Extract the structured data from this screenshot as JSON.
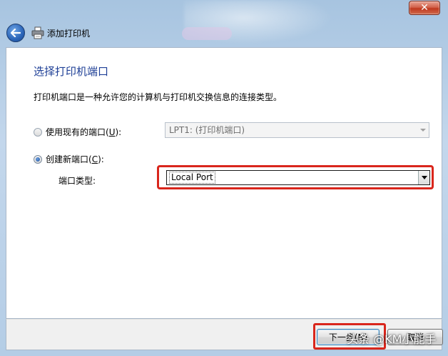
{
  "window": {
    "title": "添加打印机",
    "close_glyph": "✕"
  },
  "page": {
    "heading": "选择打印机端口",
    "description": "打印机端口是一种允许您的计算机与打印机交换信息的连接类型。"
  },
  "options": {
    "existing_port": {
      "label_prefix": "使用现有的端口(",
      "label_accel": "U",
      "label_suffix": "):",
      "selected": false,
      "value": "LPT1: (打印机端口)"
    },
    "new_port": {
      "label_prefix": "创建新端口(",
      "label_accel": "C",
      "label_suffix": "):",
      "selected": true,
      "port_type_label": "端口类型:",
      "port_type_value": "Local Port"
    }
  },
  "buttons": {
    "next": "下一步(N)",
    "cancel": "取消"
  },
  "watermark": "头条 @KM小能手",
  "colors": {
    "heading": "#1e3f96",
    "highlight": "#d9261c"
  }
}
